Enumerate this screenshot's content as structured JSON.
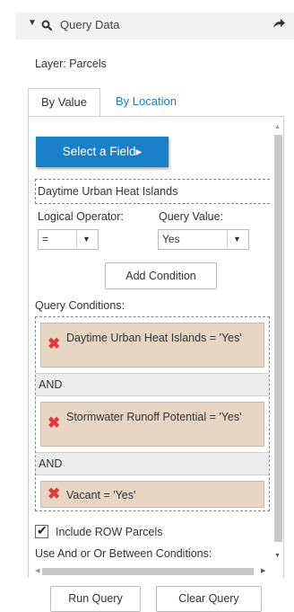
{
  "header": {
    "title": "Query Data",
    "collapse_icon": "chevron-down-icon",
    "query_icon": "search-icon",
    "share_icon": "share-arrow-icon"
  },
  "layer_label": "Layer: Parcels",
  "tabs": [
    {
      "label": "By Value",
      "active": true
    },
    {
      "label": "By Location",
      "active": false
    }
  ],
  "select_field": {
    "label": "Select a Field",
    "arrow": "▸"
  },
  "selected_field": "Daytime Urban Heat Islands",
  "logical_operator": {
    "label": "Logical Operator:",
    "value": "="
  },
  "query_value": {
    "label": "Query Value:",
    "value": "Yes"
  },
  "add_condition_label": "Add Condition",
  "query_conditions": {
    "label": "Query Conditions:",
    "conditions": [
      {
        "text": "Daytime Urban Heat Islands = 'Yes'"
      },
      {
        "text": "Stormwater Runoff Potential = 'Yes'"
      },
      {
        "text": "Vacant = 'Yes'"
      }
    ],
    "joiners": [
      "AND",
      "AND"
    ]
  },
  "include_row": {
    "label": "Include ROW Parcels",
    "checked": true
  },
  "and_or_label": "Use And or Or Between Conditions:",
  "buttons": {
    "run": "Run Query",
    "clear": "Clear Query"
  },
  "colors": {
    "accent_blue": "#1a7fc9",
    "condition_bg": "#e6d6c3",
    "remove_red": "#e23b3b",
    "header_bg": "#f2f2f2"
  }
}
